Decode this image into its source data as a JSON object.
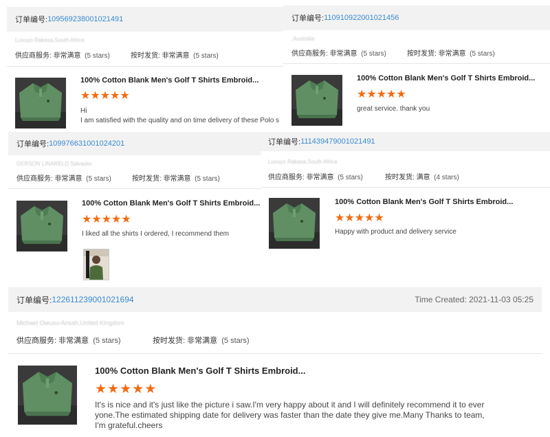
{
  "reviews": [
    {
      "order_label": "订单编号:",
      "order_no": "109569238001021491",
      "location": "Luvuyo Rakasa,South Africa",
      "supplier_label": "供应商服务:",
      "supplier_value": "非常满意",
      "supplier_stars": "(5 stars)",
      "delivery_label": "按时发货:",
      "delivery_value": "非常满意",
      "delivery_stars": "(5 stars)",
      "product_title": "100% Cotton Blank Men's Golf T Shirts Embroid...",
      "rating": 5,
      "review_text": "Hi\nI am satisfied with the quality and on time delivery of these Polo s"
    },
    {
      "order_label": "订单编号:",
      "order_no": "110910922001021456",
      "location": ",Australia",
      "supplier_label": "供应商服务:",
      "supplier_value": "非常满意",
      "supplier_stars": "(5 stars)",
      "delivery_label": "按时发货:",
      "delivery_value": "非常满意",
      "delivery_stars": "(5 stars)",
      "product_title": "100% Cotton Blank Men's Golf T Shirts Embroid...",
      "rating": 5,
      "review_text": "great service. thank you"
    },
    {
      "order_label": "订单编号:",
      "order_no": "109976631001024201",
      "location": "GERSON LINARELD Salvador",
      "supplier_label": "供应商服务:",
      "supplier_value": "非常满意",
      "supplier_stars": "(5 stars)",
      "delivery_label": "按时发货:",
      "delivery_value": "非常满意",
      "delivery_stars": "(5 stars)",
      "product_title": "100% Cotton Blank Men's Golf T Shirts Embroid...",
      "rating": 5,
      "review_text": "I liked all the shirts I ordered, I recommend them"
    },
    {
      "order_label": "订单编号:",
      "order_no": "111439479001021491",
      "location": "Luvuyo Rakasa,South Africa",
      "supplier_label": "供应商服务:",
      "supplier_value": "非常满意",
      "supplier_stars": "(5 stars)",
      "delivery_label": "按时发货:",
      "delivery_value": "满意",
      "delivery_stars": "(4 stars)",
      "product_title": "100% Cotton Blank Men's Golf T Shirts Embroid...",
      "rating": 5,
      "review_text": "Happy with product and delivery service"
    },
    {
      "order_label": "订单编号:",
      "order_no": "122611239001021694",
      "time_created": "Time Created: 2021-11-03 05:25",
      "location": "Michael Owusu-Ansah,United Kingdom",
      "supplier_label": "供应商服务:",
      "supplier_value": "非常满意",
      "supplier_stars": "(5 stars)",
      "delivery_label": "按时发货:",
      "delivery_value": "非常满意",
      "delivery_stars": "(5 stars)",
      "product_title": "100% Cotton Blank Men's Golf T Shirts Embroid...",
      "rating": 5,
      "review_text": "It's is nice and it's just like the picture i saw.I'm very happy about it and I will definitely recommend it to ever yone.The estimated shipping date for delivery was faster than the date they give me.Many Thanks to team, I'm grateful.cheers"
    }
  ],
  "icons": {
    "star": "star-icon"
  },
  "colors": {
    "accent_blue": "#3a8ad1",
    "star_orange": "#f36b12",
    "header_gray": "#f2f2f2"
  }
}
